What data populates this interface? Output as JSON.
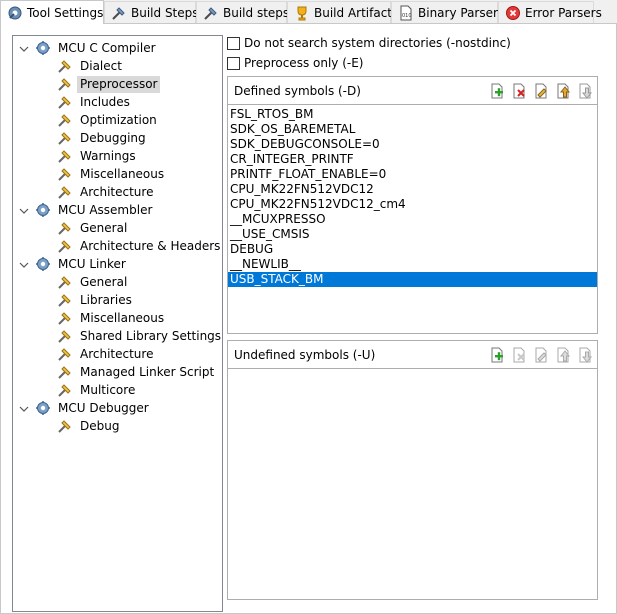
{
  "tabs": [
    {
      "label": "Tool Settings",
      "icon": "tool-settings-icon",
      "active": true
    },
    {
      "label": "Build Steps",
      "icon": "build-steps-icon",
      "active": false
    },
    {
      "label": "Build steps",
      "icon": "build-steps-icon",
      "active": false
    },
    {
      "label": "Build Artifact",
      "icon": "build-artifact-icon",
      "active": false
    },
    {
      "label": "Binary Parsers",
      "icon": "binary-parsers-icon",
      "active": false
    },
    {
      "label": "Error Parsers",
      "icon": "error-parsers-icon",
      "active": false
    }
  ],
  "tree": {
    "groups": [
      {
        "label": "MCU C Compiler",
        "children": [
          "Dialect",
          "Preprocessor",
          "Includes",
          "Optimization",
          "Debugging",
          "Warnings",
          "Miscellaneous",
          "Architecture"
        ]
      },
      {
        "label": "MCU Assembler",
        "children": [
          "General",
          "Architecture & Headers"
        ]
      },
      {
        "label": "MCU Linker",
        "children": [
          "General",
          "Libraries",
          "Miscellaneous",
          "Shared Library Settings",
          "Architecture",
          "Managed Linker Script",
          "Multicore"
        ]
      },
      {
        "label": "MCU Debugger",
        "children": [
          "Debug"
        ]
      }
    ],
    "selected": "Preprocessor"
  },
  "options": {
    "nostdinc_label": "Do not search system directories (-nostdinc)",
    "nostdinc_checked": false,
    "preprocess_only_label": "Preprocess only (-E)",
    "preprocess_only_checked": false
  },
  "defined_symbols": {
    "title": "Defined symbols (-D)",
    "items": [
      "FSL_RTOS_BM",
      "SDK_OS_BAREMETAL",
      "SDK_DEBUGCONSOLE=0",
      "CR_INTEGER_PRINTF",
      "PRINTF_FLOAT_ENABLE=0",
      "CPU_MK22FN512VDC12",
      "CPU_MK22FN512VDC12_cm4",
      "__MCUXPRESSO",
      "__USE_CMSIS",
      "DEBUG",
      "__NEWLIB__",
      "USB_STACK_BM"
    ],
    "selected": "USB_STACK_BM"
  },
  "undefined_symbols": {
    "title": "Undefined symbols (-U)",
    "items": []
  },
  "toolbar_icons": [
    "add-icon",
    "delete-icon",
    "edit-icon",
    "move-up-icon",
    "move-down-icon"
  ],
  "colors": {
    "selection": "#0078d7",
    "tree_selection": "#d9d9d9"
  }
}
